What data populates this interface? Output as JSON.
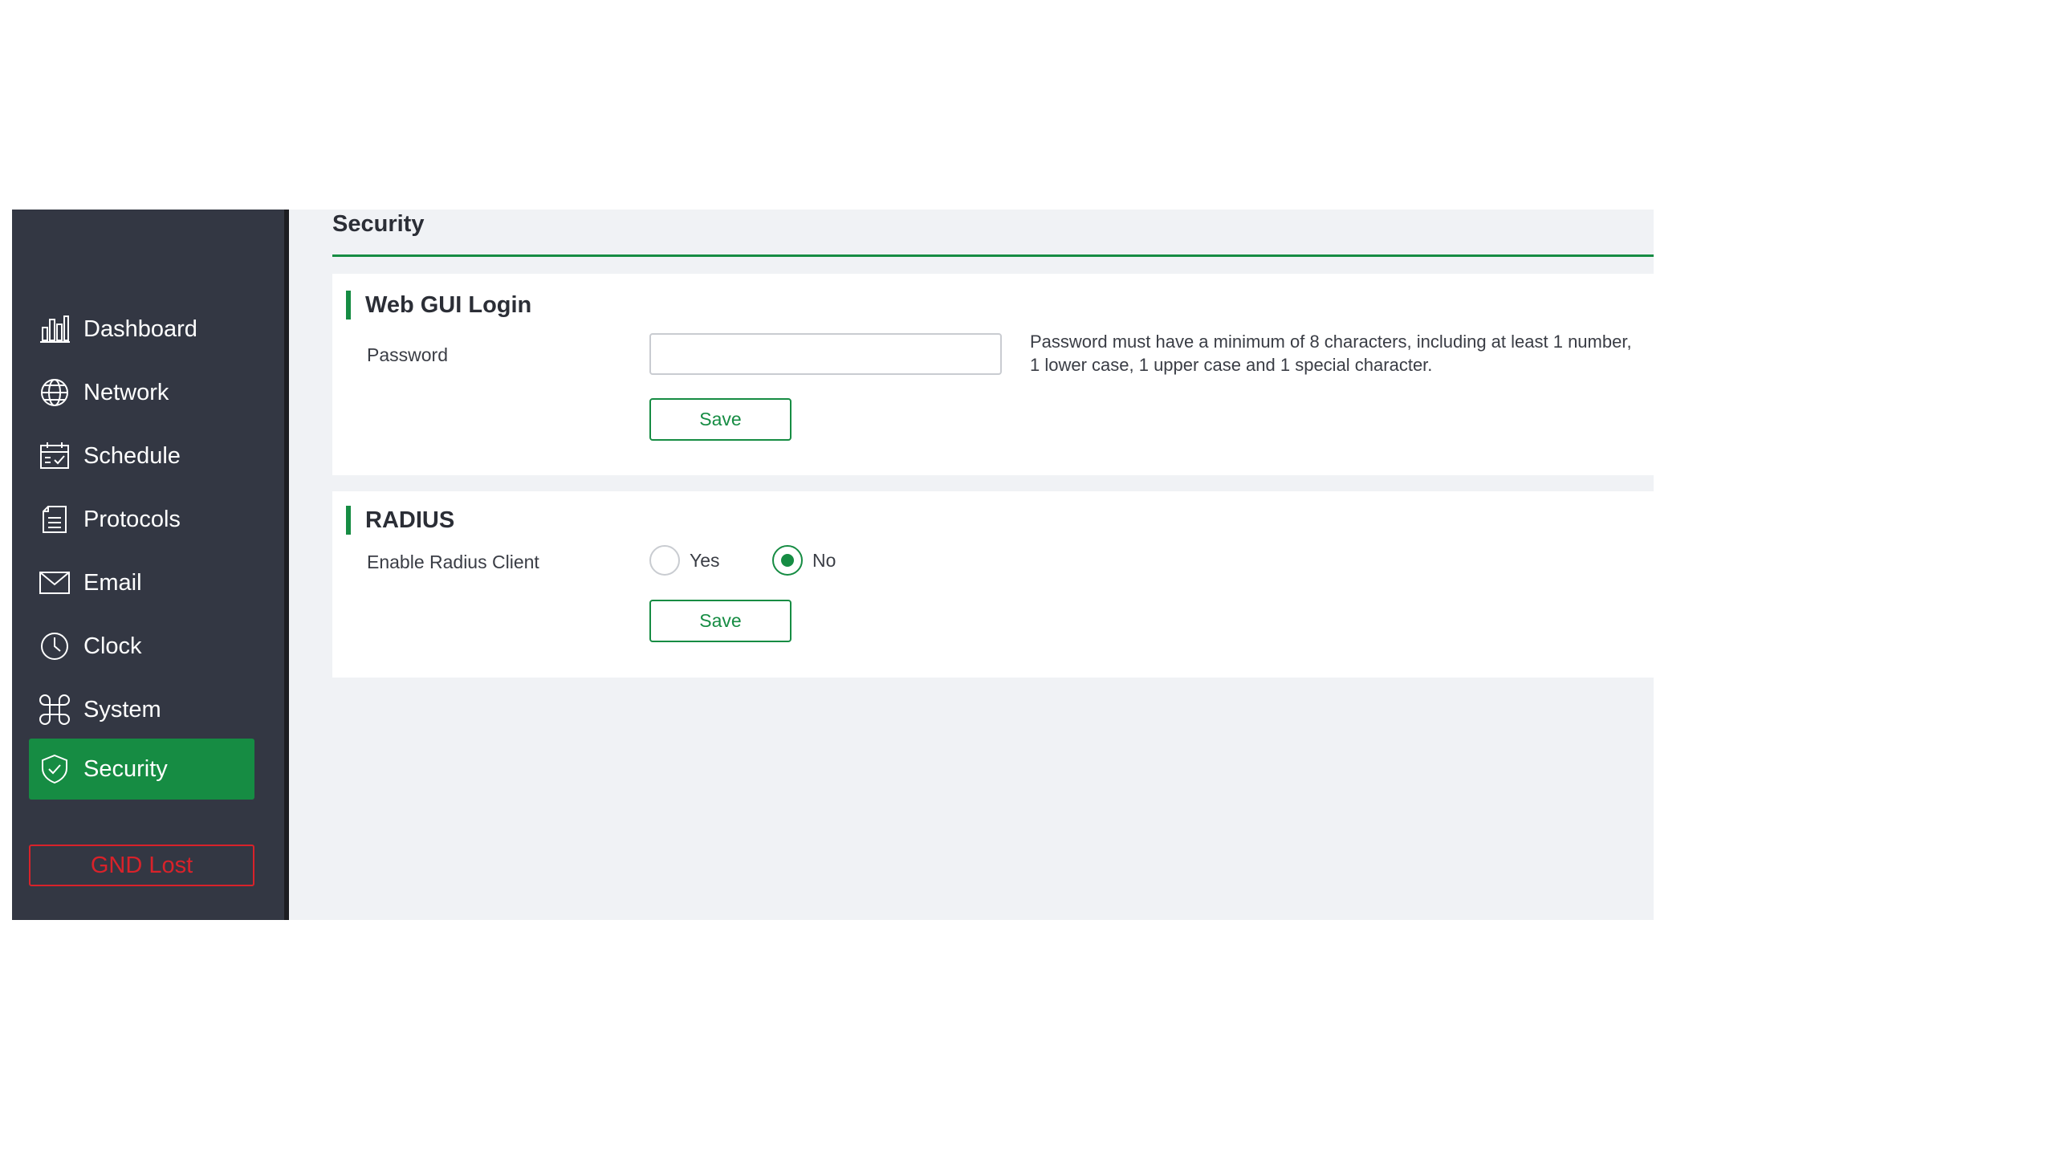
{
  "sidebar": {
    "items": [
      {
        "label": "Dashboard",
        "icon": "bar-chart-icon"
      },
      {
        "label": "Network",
        "icon": "globe-icon"
      },
      {
        "label": "Schedule",
        "icon": "calendar-icon"
      },
      {
        "label": "Protocols",
        "icon": "document-icon"
      },
      {
        "label": "Email",
        "icon": "envelope-icon"
      },
      {
        "label": "Clock",
        "icon": "clock-icon"
      },
      {
        "label": "System",
        "icon": "command-icon"
      },
      {
        "label": "Security",
        "icon": "shield-icon",
        "active": true
      }
    ],
    "status": "GND Lost"
  },
  "page": {
    "title": "Security"
  },
  "web_gui_login": {
    "title": "Web GUI Login",
    "password_label": "Password",
    "password_value": "",
    "help": "Password must have a minimum of 8 characters, including at least 1 number, 1 lower case, 1 upper case and 1 special character.",
    "save_label": "Save"
  },
  "radius": {
    "title": "RADIUS",
    "enable_label": "Enable Radius Client",
    "options": [
      {
        "label": "Yes",
        "checked": false
      },
      {
        "label": "No",
        "checked": true
      }
    ],
    "save_label": "Save"
  },
  "colors": {
    "accent": "#168c43",
    "sidebar": "#333743",
    "error": "#d9222a",
    "background": "#f0f2f5"
  }
}
